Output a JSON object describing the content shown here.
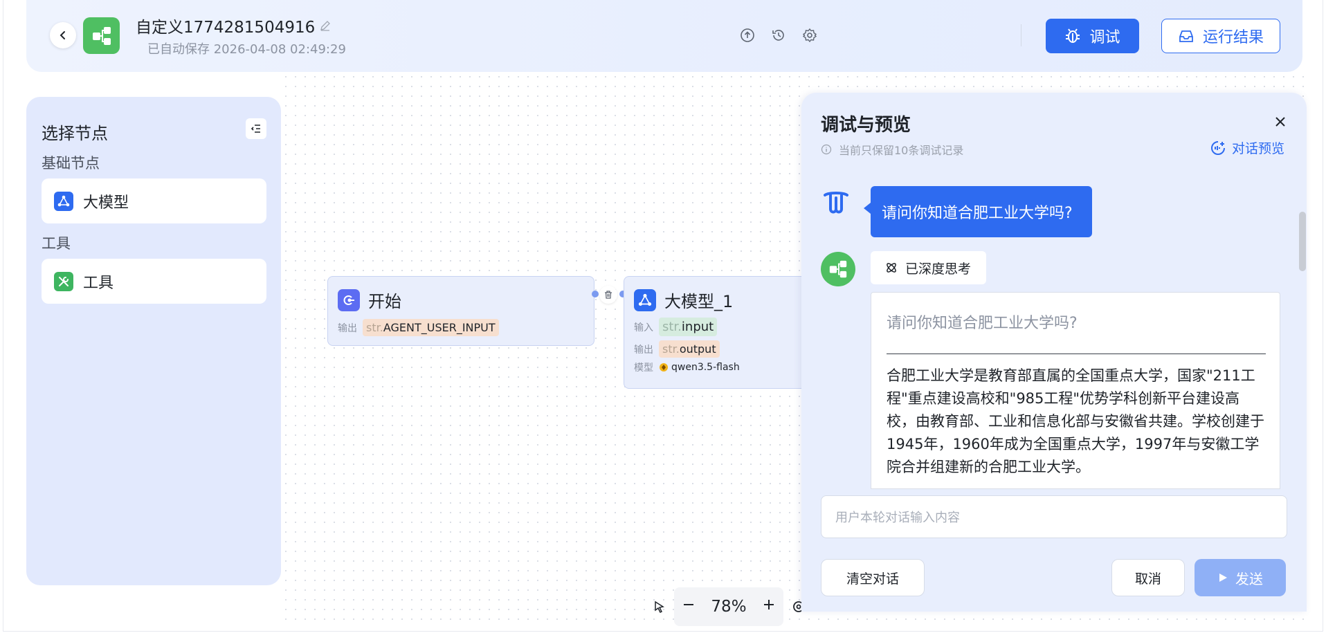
{
  "header": {
    "title": "自定义1774281504916",
    "save_status": "已自动保存 2026-04-08 02:49:29",
    "debug_label": "调试",
    "result_label": "运行结果"
  },
  "left_panel": {
    "title": "选择节点",
    "section_basic": "基础节点",
    "item_llm": "大模型",
    "section_tools": "工具",
    "item_tool": "工具"
  },
  "nodes": {
    "start": {
      "title": "开始",
      "output_label": "输出",
      "output_type": "str.",
      "output_name": "AGENT_USER_INPUT"
    },
    "llm": {
      "title": "大模型_1",
      "input_label": "输入",
      "input_type": "str.",
      "input_name": "input",
      "output_label": "输出",
      "output_type": "str.",
      "output_name": "output",
      "model_label": "模型",
      "model_name": "qwen3.5-flash"
    }
  },
  "toolbar": {
    "zoom": "78%"
  },
  "debug_panel": {
    "title": "调试与预览",
    "note": "当前只保留10条调试记录",
    "preview_label": "对话预览",
    "user_message": "请问你知道合肥工业大学吗?",
    "think_label": "已深度思考",
    "answer_question": "请问你知道合肥工业大学吗?",
    "answer_body": "合肥工业大学是教育部直属的全国重点大学，国家\"211工程\"重点建设高校和\"985工程\"优势学科创新平台建设高校，由教育部、工业和信息化部与安徽省共建。学校创建于1945年，1960年成为全国重点大学，1997年与安徽工学院合并组建新的合肥工业大学。",
    "input_placeholder": "用户本轮对话输入内容",
    "clear_label": "清空对话",
    "cancel_label": "取消",
    "send_label": "发送"
  },
  "colors": {
    "accent": "#2e6bf0",
    "app_green": "#4fbf62",
    "panel_bg": "#e2e9fd"
  }
}
